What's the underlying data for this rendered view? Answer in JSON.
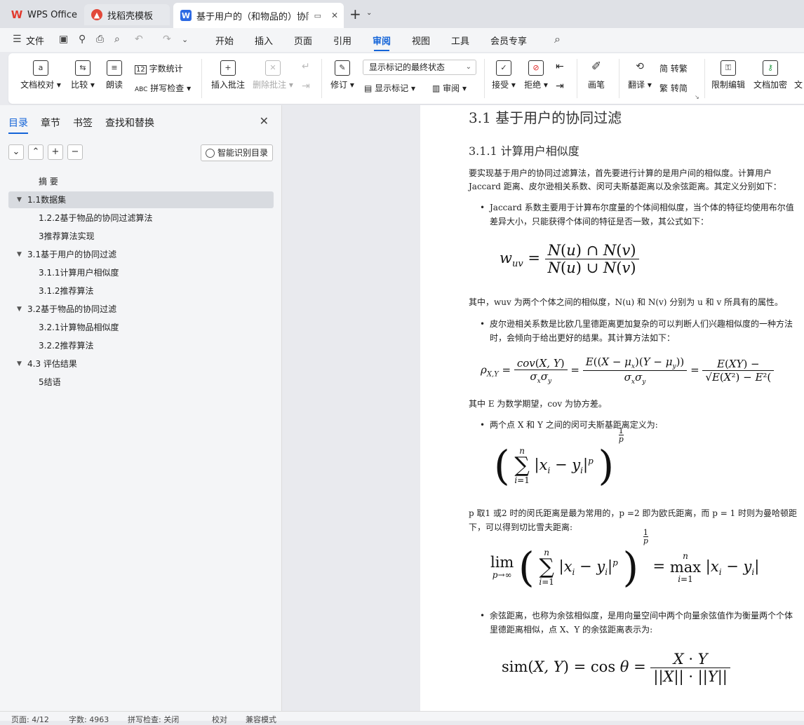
{
  "tabs": [
    {
      "label": "WPS Office"
    },
    {
      "label": "找稻壳模板"
    },
    {
      "label": "基于用户的（和物品的）协同过"
    }
  ],
  "menu": [
    "文件",
    "开始",
    "插入",
    "页面",
    "引用",
    "审阅",
    "视图",
    "工具",
    "会员专享"
  ],
  "ribbon": {
    "doc_check": "文档校对",
    "compare": "比较",
    "read_aloud": "朗读",
    "word_count": "字数统计",
    "spell_check": "拼写检查",
    "insert_comment": "插入批注",
    "delete_comment": "删除批注",
    "revise": "修订",
    "markup_state": "显示标记的最终状态",
    "show_markup": "显示标记",
    "review": "审阅",
    "accept": "接受",
    "reject": "拒绝",
    "pen": "画笔",
    "translate": "翻译",
    "to_traditional": "转繁",
    "to_simplified": "转简",
    "restrict_edit": "限制编辑",
    "encrypt": "文档加密",
    "doc_more": "文"
  },
  "sidebar": {
    "tabs": [
      "目录",
      "章节",
      "书签",
      "查找和替换"
    ],
    "smart_toc": "智能识别目录",
    "toc": [
      {
        "label": "摘  要",
        "level": 2,
        "expandable": false
      },
      {
        "label": "1.1数据集",
        "level": 1,
        "expandable": true,
        "selected": true
      },
      {
        "label": "1.2.2基于物品的协同过滤算法",
        "level": 2,
        "expandable": false
      },
      {
        "label": "3推荐算法实现",
        "level": 2,
        "expandable": false
      },
      {
        "label": "3.1基于用户的协同过滤",
        "level": 1,
        "expandable": true
      },
      {
        "label": "3.1.1计算用户相似度",
        "level": 2,
        "expandable": false
      },
      {
        "label": "3.1.2推荐算法",
        "level": 2,
        "expandable": false
      },
      {
        "label": "3.2基于物品的协同过滤",
        "level": 1,
        "expandable": true
      },
      {
        "label": "3.2.1计算物品相似度",
        "level": 2,
        "expandable": false
      },
      {
        "label": "3.2.2推荐算法",
        "level": 2,
        "expandable": false
      },
      {
        "label": "4.3 评估结果",
        "level": 1,
        "expandable": true
      },
      {
        "label": "5结语",
        "level": 2,
        "expandable": false
      }
    ]
  },
  "doc": {
    "h2": "3.1 基于用户的协同过滤",
    "h3": "3.1.1   计算用户相似度",
    "p1a": "要实现基于用户的协同过滤算法，首先要进行计算的是用户间的相似度。计算用户",
    "p1b": "Jaccard 距离、皮尔逊相关系数、闵可夫斯基距离以及余弦距离。其定义分别如下：",
    "b1a": "Jaccard 系数主要用于计算布尔度量的个体间相似度，当个体的特征均使用布尔值",
    "b1b": "差异大小，只能获得个体间的特征是否一致，其公式如下：",
    "p2": "其中，wuv 为两个个体之间的相似度，N(u) 和 N(v) 分别为 u 和 v 所具有的属性。",
    "b2a": "皮尔逊相关系数是比欧几里德距离更加复杂的可以判断人们兴趣相似度的一种方法",
    "b2b": "时，会倾向于给出更好的结果。其计算方法如下：",
    "p3": "其中 E 为数学期望，cov 为协方差。",
    "b3": "两个点 X 和 Y 之间的闵可夫斯基距离定义为:",
    "p4a": "p 取1 或2 时的闵氏距离是最为常用的，p =2 即为欧氏距离，而 p = 1 时则为曼哈顿距",
    "p4b": "下，可以得到切比雪夫距离:",
    "b4a": "余弦距离，也称为余弦相似度，是用向量空间中两个向量余弦值作为衡量两个个体",
    "b4b": "里德距离相似，点 X、Y 的余弦距离表示为:"
  },
  "status": {
    "page": "页面: 4/12",
    "words": "字数: 4963",
    "spell": "拼写检查: 关闭",
    "proof": "校对",
    "compat": "兼容模式"
  }
}
